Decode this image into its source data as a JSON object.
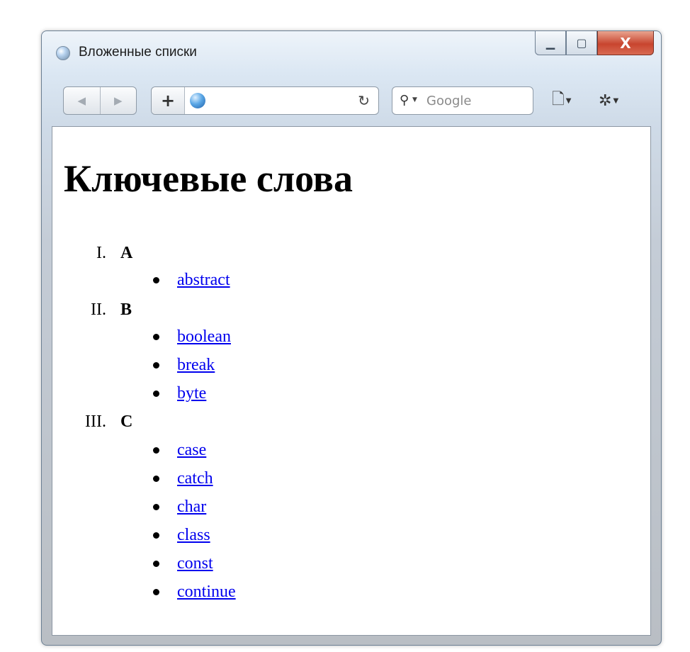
{
  "window": {
    "title": "Вложенные списки",
    "caption_buttons": {
      "minimize": "▁",
      "maximize": "▢",
      "close": "X"
    }
  },
  "toolbar": {
    "back": "◀",
    "forward": "▶",
    "add": "+",
    "reload": "↻",
    "search_placeholder": "Google",
    "page_menu": "🗋",
    "settings_menu": "✲"
  },
  "page": {
    "heading": "Ключевые слова",
    "groups": [
      {
        "marker": "I.",
        "label": "A",
        "items": [
          "abstract"
        ]
      },
      {
        "marker": "II.",
        "label": "B",
        "items": [
          "boolean",
          "break",
          "byte"
        ]
      },
      {
        "marker": "III.",
        "label": "C",
        "items": [
          "case",
          "catch",
          "char",
          "class",
          "const",
          "continue"
        ]
      }
    ]
  },
  "colors": {
    "link": "#0000ee",
    "close_button": "#c8452f"
  }
}
